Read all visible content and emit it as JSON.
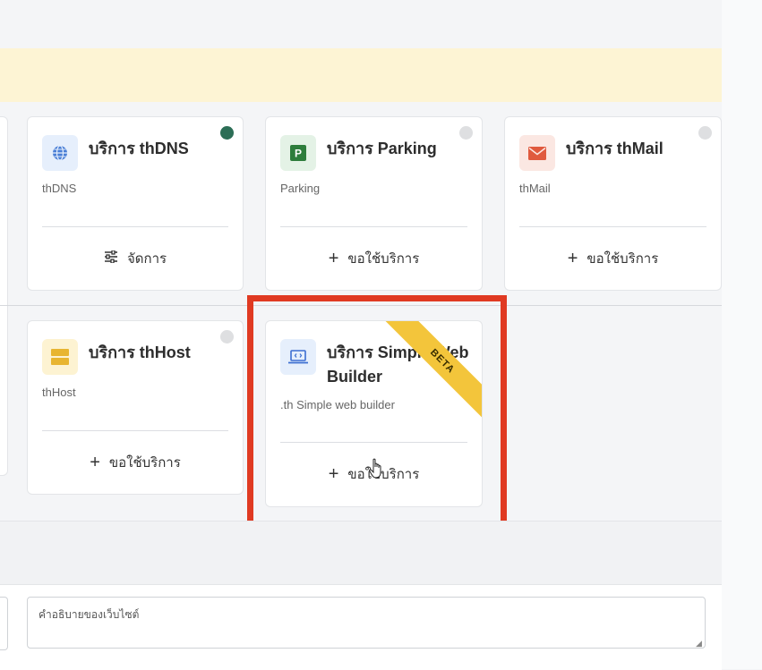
{
  "services": [
    {
      "title": "บริการ thDNS",
      "subtitle": "thDNS",
      "action_glyph": "☰",
      "action_label": "จัดการ",
      "icon": "globe-icon",
      "status": "active"
    },
    {
      "title": "บริการ Parking",
      "subtitle": "Parking",
      "action_glyph": "+",
      "action_label": "ขอใช้บริการ",
      "icon": "parking-icon",
      "status": "inactive"
    },
    {
      "title": "บริการ thMail",
      "subtitle": "thMail",
      "action_glyph": "+",
      "action_label": "ขอใช้บริการ",
      "icon": "mail-icon",
      "status": "inactive"
    },
    {
      "title": "บริการ thHost",
      "subtitle": "thHost",
      "action_glyph": "+",
      "action_label": "ขอใช้บริการ",
      "icon": "server-icon",
      "status": "inactive"
    },
    {
      "title": "บริการ Simple Web Builder",
      "subtitle": ".th Simple web builder",
      "action_glyph": "+",
      "action_label": "ขอใช้บริการ",
      "icon": "code-laptop-icon",
      "badge": "BETA"
    }
  ],
  "description_input": {
    "placeholder": "คำอธิบายของเว็บไซต์",
    "value": ""
  },
  "colors": {
    "alert_bg": "#fdf4d4",
    "status_active": "#2c6e56",
    "status_inactive": "#dedfe1",
    "beta_ribbon": "#f3c53b",
    "highlight_frame": "#e03a22"
  }
}
